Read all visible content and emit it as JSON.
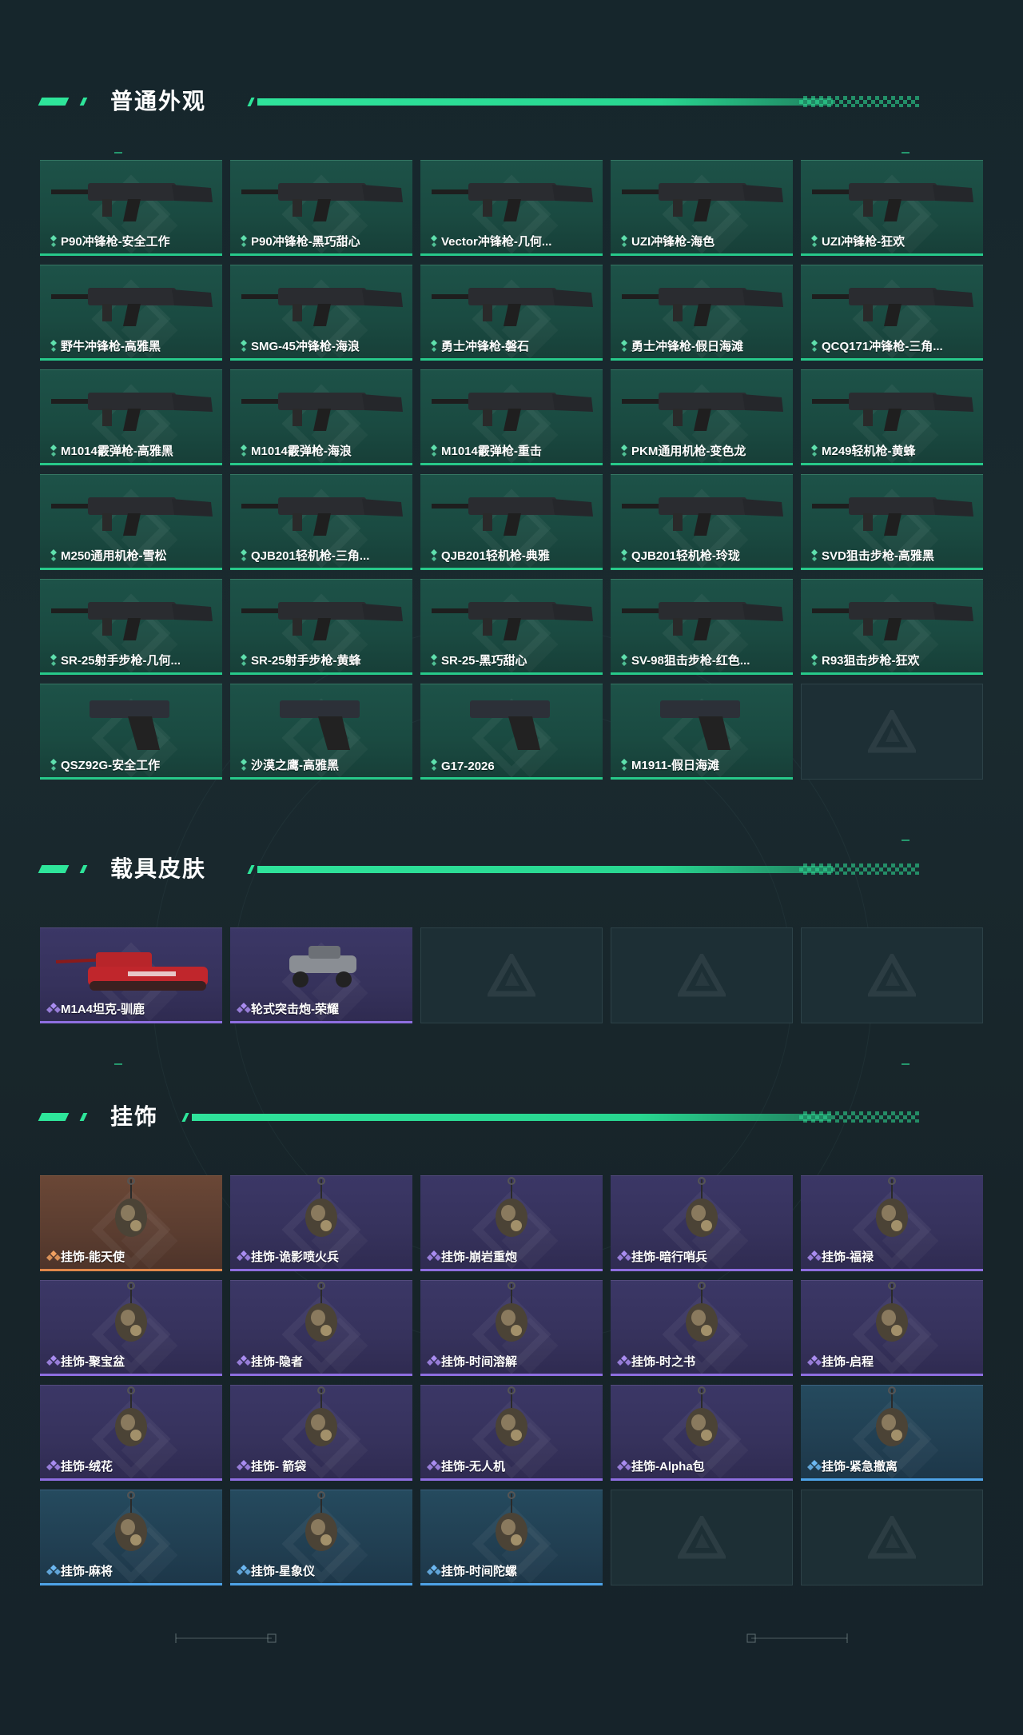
{
  "sections": {
    "weapons": {
      "title": "普通外观",
      "items": [
        {
          "label": "P90冲锋枪-安全工作",
          "rarity": "green",
          "icon": "smg-p90-yellow-icon"
        },
        {
          "label": "P90冲锋枪-黑巧甜心",
          "rarity": "green",
          "icon": "smg-p90-pink-icon"
        },
        {
          "label": "Vector冲锋枪-几何...",
          "rarity": "green",
          "icon": "smg-vector-camo-icon"
        },
        {
          "label": "UZI冲锋枪-海色",
          "rarity": "green",
          "icon": "smg-uzi-white-blue-icon"
        },
        {
          "label": "UZI冲锋枪-狂欢",
          "rarity": "green",
          "icon": "smg-uzi-carnival-icon"
        },
        {
          "label": "野牛冲锋枪-高雅黑",
          "rarity": "green",
          "icon": "smg-bizon-black-icon"
        },
        {
          "label": "SMG-45冲锋枪-海浪",
          "rarity": "green",
          "icon": "smg-45-blue-icon"
        },
        {
          "label": "勇士冲锋枪-磐石",
          "rarity": "green",
          "icon": "smg-warrior-stone-icon"
        },
        {
          "label": "勇士冲锋枪-假日海滩",
          "rarity": "green",
          "icon": "smg-warrior-beach-icon"
        },
        {
          "label": "QCQ171冲锋枪-三角...",
          "rarity": "green",
          "icon": "smg-qcq171-icon"
        },
        {
          "label": "M1014霰弹枪-高雅黑",
          "rarity": "green",
          "icon": "shotgun-m1014-black-icon"
        },
        {
          "label": "M1014霰弹枪-海浪",
          "rarity": "green",
          "icon": "shotgun-m1014-blue-icon"
        },
        {
          "label": "M1014霰弹枪-重击",
          "rarity": "green",
          "icon": "shotgun-m1014-smash-icon"
        },
        {
          "label": "PKM通用机枪-变色龙",
          "rarity": "green",
          "icon": "mg-pkm-icon"
        },
        {
          "label": "M249轻机枪-黄蜂",
          "rarity": "green",
          "icon": "lmg-m249-wasp-icon"
        },
        {
          "label": "M250通用机枪-雪松",
          "rarity": "green",
          "icon": "mg-m250-icon"
        },
        {
          "label": "QJB201轻机枪-三角...",
          "rarity": "green",
          "icon": "lmg-qjb201-red-icon"
        },
        {
          "label": "QJB201轻机枪-典雅",
          "rarity": "green",
          "icon": "lmg-qjb201-elegant-icon"
        },
        {
          "label": "QJB201轻机枪-玲珑",
          "rarity": "green",
          "icon": "lmg-qjb201-purple-icon"
        },
        {
          "label": "SVD狙击步枪-高雅黑",
          "rarity": "green",
          "icon": "sniper-svd-icon"
        },
        {
          "label": "SR-25射手步枪-几何...",
          "rarity": "green",
          "icon": "dmr-sr25-camo-icon"
        },
        {
          "label": "SR-25射手步枪-黄蜂",
          "rarity": "green",
          "icon": "dmr-sr25-wasp-icon"
        },
        {
          "label": "SR-25-黑巧甜心",
          "rarity": "green",
          "icon": "dmr-sr25-pink-icon"
        },
        {
          "label": "SV-98狙击步枪-红色...",
          "rarity": "green",
          "icon": "sniper-sv98-red-icon"
        },
        {
          "label": "R93狙击步枪-狂欢",
          "rarity": "green",
          "icon": "sniper-r93-icon"
        },
        {
          "label": "QSZ92G-安全工作",
          "rarity": "green",
          "icon": "pistol-qsz92g-icon"
        },
        {
          "label": "沙漠之鹰-高雅黑",
          "rarity": "green",
          "icon": "pistol-deagle-icon"
        },
        {
          "label": "G17-2026",
          "rarity": "green",
          "icon": "pistol-g17-icon"
        },
        {
          "label": "M1911-假日海滩",
          "rarity": "green",
          "icon": "pistol-m1911-icon"
        },
        {
          "label": "",
          "rarity": "empty",
          "icon": "empty-slot-logo-icon"
        }
      ]
    },
    "vehicles": {
      "title": "载具皮肤",
      "items": [
        {
          "label": "M1A4坦克-驯鹿",
          "rarity": "purple",
          "icon": "tank-m1a4-icon"
        },
        {
          "label": "轮式突击炮-荣耀",
          "rarity": "purple",
          "icon": "wheeled-assault-gun-icon"
        },
        {
          "label": "",
          "rarity": "empty",
          "icon": "empty-slot-logo-icon"
        },
        {
          "label": "",
          "rarity": "empty",
          "icon": "empty-slot-logo-icon"
        },
        {
          "label": "",
          "rarity": "empty",
          "icon": "empty-slot-logo-icon"
        }
      ]
    },
    "charms": {
      "title": "挂饰",
      "items": [
        {
          "label": "挂饰-能天使",
          "rarity": "orange",
          "icon": "charm-exusiai-icon"
        },
        {
          "label": "挂饰-诡影喷火兵",
          "rarity": "purple",
          "icon": "charm-flamethrower-icon"
        },
        {
          "label": "挂饰-崩岩重炮",
          "rarity": "purple",
          "icon": "charm-heavy-artillery-icon"
        },
        {
          "label": "挂饰-暗行哨兵",
          "rarity": "purple",
          "icon": "charm-sentinel-icon"
        },
        {
          "label": "挂饰-福禄",
          "rarity": "purple",
          "icon": "charm-gourd-icon"
        },
        {
          "label": "挂饰-聚宝盆",
          "rarity": "purple",
          "icon": "charm-treasure-bowl-icon"
        },
        {
          "label": "挂饰-隐者",
          "rarity": "purple",
          "icon": "charm-hermit-card-icon"
        },
        {
          "label": "挂饰-时间溶解",
          "rarity": "purple",
          "icon": "charm-melting-clock-icon"
        },
        {
          "label": "挂饰-时之书",
          "rarity": "purple",
          "icon": "charm-book-icon"
        },
        {
          "label": "挂饰-启程",
          "rarity": "purple",
          "icon": "charm-compass-icon"
        },
        {
          "label": "挂饰-绒花",
          "rarity": "purple",
          "icon": "charm-velvet-flower-icon"
        },
        {
          "label": "挂饰- 箭袋",
          "rarity": "purple",
          "icon": "charm-quiver-icon"
        },
        {
          "label": "挂饰-无人机",
          "rarity": "purple",
          "icon": "charm-drone-icon"
        },
        {
          "label": "挂饰-Alpha包",
          "rarity": "purple",
          "icon": "charm-alpha-bag-icon"
        },
        {
          "label": "挂饰-紧急撤离",
          "rarity": "blue",
          "icon": "charm-emergency-exit-icon"
        },
        {
          "label": "挂饰-麻将",
          "rarity": "blue",
          "icon": "charm-mahjong-icon"
        },
        {
          "label": "挂饰-星象仪",
          "rarity": "blue",
          "icon": "charm-astrolabe-icon"
        },
        {
          "label": "挂饰-时间陀螺",
          "rarity": "blue",
          "icon": "charm-time-gyro-icon"
        },
        {
          "label": "",
          "rarity": "empty",
          "icon": "empty-slot-logo-icon"
        },
        {
          "label": "",
          "rarity": "empty",
          "icon": "empty-slot-logo-icon"
        }
      ]
    }
  },
  "colors": {
    "accent": "#2ee59a",
    "green": "#27c98a",
    "purple": "#8e6ee0",
    "orange": "#e0874a",
    "blue": "#4ea3e8"
  },
  "footer": {
    "left_ticks": [
      "2025.5",
      "2025.5"
    ],
    "right_ticks": [
      "2025.5",
      "2025.5"
    ]
  }
}
